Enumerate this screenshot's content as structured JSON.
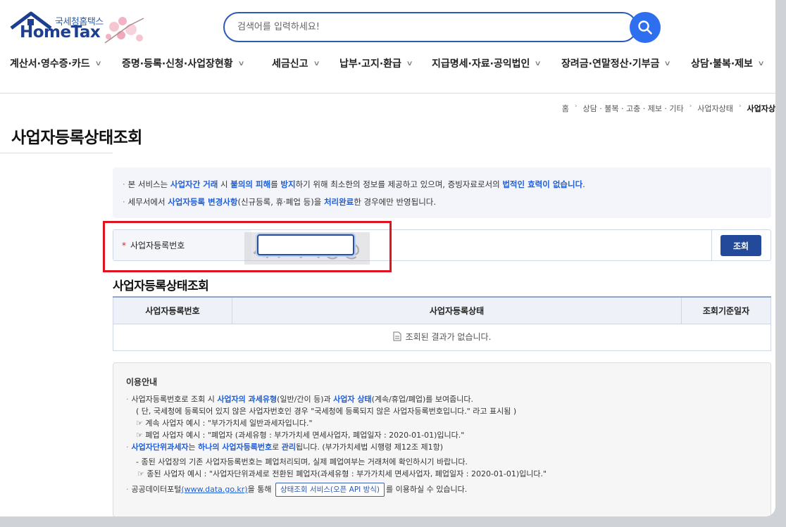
{
  "header": {
    "logo_kr": "국세청홈택스",
    "logo_en": "HomeTax",
    "search_placeholder": "검색어를 입력하세요!"
  },
  "gnb": [
    {
      "label": "계산서·영수증·카드"
    },
    {
      "label": "증명·등록·신청·사업장현황"
    },
    {
      "label": "세금신고"
    },
    {
      "label": "납부·고지·환급"
    },
    {
      "label": "지급명세·자료·공익법인"
    },
    {
      "label": "장려금·연말정산·기부금"
    },
    {
      "label": "상담·불복·제보"
    }
  ],
  "breadcrumb": [
    "홈",
    "상담 · 불복 · 고충 · 제보 · 기타",
    "사업자상태",
    "사업자상"
  ],
  "page_title": "사업자등록상태조회",
  "notice": {
    "line1": [
      "본 서비스는 ",
      "사업자간 거래",
      " 시 ",
      "불의의 피해",
      "를 ",
      "방지",
      "하기 위해 최소한의 정보를 제공하고 있으며, 증빙자료로서의 ",
      "법적인 효력이 없습니다",
      "."
    ],
    "line2": [
      "세무서에서 ",
      "사업자등록 변경사항",
      "(신규등록, 휴·폐업 등)을 ",
      "처리완료",
      "한 경우에만 반영됩니다."
    ]
  },
  "form": {
    "required_mark": "*",
    "label": "사업자등록번호",
    "input_value": "",
    "watermark": "세무사마@@",
    "query_button": "조회"
  },
  "result": {
    "title": "사업자등록상태조회",
    "columns": [
      "사업자등록번호",
      "사업자등록상태",
      "조회기준일자"
    ],
    "empty_message": "조회된 결과가 없습니다."
  },
  "info": {
    "title": "이용안내",
    "l1": [
      "사업자등록번호로 조회 시 ",
      "사업자의 과세유형",
      "(일반/간이 등)과 ",
      "사업자 상태",
      "(계속/휴업/폐업)를 보여줍니다."
    ],
    "l2": "( 단, 국세청에 등록되어 있지 않은 사업자번호인 경우 \"국세청에 등록되지 않은 사업자등록번호입니다.\" 라고 표시됨 )",
    "l3": "☞ 계속 사업자 예시 : \"부가가치세 일반과세자입니다.\"",
    "l4": "☞ 폐업 사업자 예시 : \"폐업자 (과세유형 : 부가가치세 면세사업자, 폐업일자 : 2020-01-01)입니다.\"",
    "l5": [
      "사업자단위과세자",
      "는 ",
      "하나의 사업자등록번호",
      "로 ",
      "관리",
      "됩니다. (부가가치세법 시행령 제12조 제1항)"
    ],
    "l6": "- 종된 사업장의 기존 사업자등록번호는 폐업처리되며, 실제 폐업여부는 거래처에 확인하시기 바랍니다.",
    "l7": "☞ 종된 사업자 예시 : \"사업자단위과세로 전환된 폐업자(과세유형 : 부가가치세 면세사업자, 폐업일자 : 2020-01-01)입니다.\"",
    "l8_pre": "공공데이터포털",
    "l8_link": "(www.data.go.kr)",
    "l8_mid": "을 통해",
    "l8_btn": "상태조회 서비스(오픈 API 방식)",
    "l8_post": "를 이용하실 수 있습니다."
  },
  "colors": {
    "accent": "#2b5ab6",
    "highlight": "#1f5ed8",
    "button": "#234a9a",
    "annotation": "#e0141f"
  }
}
